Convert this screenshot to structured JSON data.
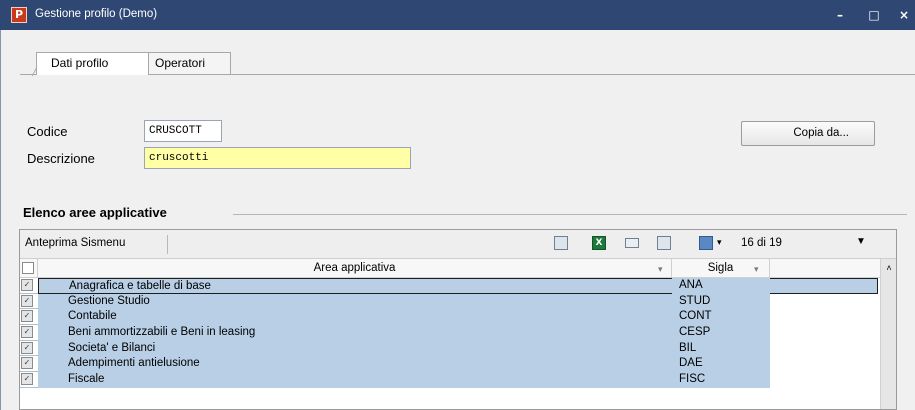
{
  "window": {
    "title": "Gestione profilo  (Demo)",
    "app_icon_glyph": "P",
    "minimize_glyph": "–",
    "maximize_glyph": "□",
    "close_glyph": "×",
    "titlebar_color": "#2f4873"
  },
  "tabs": [
    {
      "label": "Dati profilo",
      "active": true
    },
    {
      "label": "Operatori",
      "active": false
    }
  ],
  "form": {
    "codice_label": "Codice",
    "codice_value": "CRUSCOTT",
    "descrizione_label": "Descrizione",
    "descrizione_value": "cruscotti",
    "copy_button_label": "Copia da..."
  },
  "section": {
    "title": "Elenco aree applicative"
  },
  "toolbar": {
    "preview_label": "Anteprima Sismenu",
    "icons": [
      "print-preview-icon",
      "excel-export-icon",
      "layout-icon",
      "filter-toggle-icon",
      "column-chooser-icon"
    ],
    "count_text": "16 di 19",
    "dropdown_glyph": "▾",
    "caret_glyph": "▼"
  },
  "grid": {
    "columns": [
      {
        "label": "Area applicativa"
      },
      {
        "label": "Sigla"
      }
    ],
    "sort_glyph": "▾",
    "check_glyph": "✓",
    "scroll_up_glyph": "˄",
    "selection_color": "#b8cfe6",
    "rows": [
      {
        "area": "Anagrafica e tabelle di base",
        "sigla": "ANA",
        "checked": true
      },
      {
        "area": "Gestione Studio",
        "sigla": "STUD",
        "checked": true
      },
      {
        "area": "Contabile",
        "sigla": "CONT",
        "checked": true
      },
      {
        "area": "Beni ammortizzabili e Beni in leasing",
        "sigla": "CESP",
        "checked": true
      },
      {
        "area": "Societa' e Bilanci",
        "sigla": "BIL",
        "checked": true
      },
      {
        "area": "Adempimenti antielusione",
        "sigla": "DAE",
        "checked": true
      },
      {
        "area": "Fiscale",
        "sigla": "FISC",
        "checked": true
      }
    ]
  }
}
